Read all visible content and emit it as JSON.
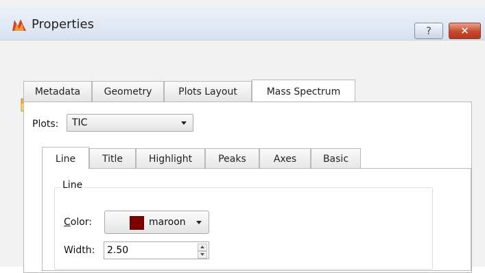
{
  "window": {
    "title": "Properties",
    "help_glyph": "?",
    "close_glyph": "✕"
  },
  "toolbar": {
    "open_icon": "folder-icon",
    "save_icon": "save-icon"
  },
  "main_tabs": [
    {
      "label": "Metadata",
      "active": false
    },
    {
      "label": "Geometry",
      "active": false
    },
    {
      "label": "Plots Layout",
      "active": false
    },
    {
      "label": "Mass Spectrum",
      "active": true
    }
  ],
  "plots": {
    "label": "Plots:",
    "value": "TIC"
  },
  "sub_tabs": [
    {
      "label": "Line",
      "active": true
    },
    {
      "label": "Title",
      "active": false
    },
    {
      "label": "Highlight",
      "active": false
    },
    {
      "label": "Peaks",
      "active": false
    },
    {
      "label": "Axes",
      "active": false
    },
    {
      "label": "Basic",
      "active": false
    }
  ],
  "line_group": {
    "title": "Line",
    "color_label_underlined": "C",
    "color_label_rest": "olor:",
    "color_value": "maroon",
    "color_hex": "#800000",
    "width_label": "Width:",
    "width_value": "2.50"
  }
}
